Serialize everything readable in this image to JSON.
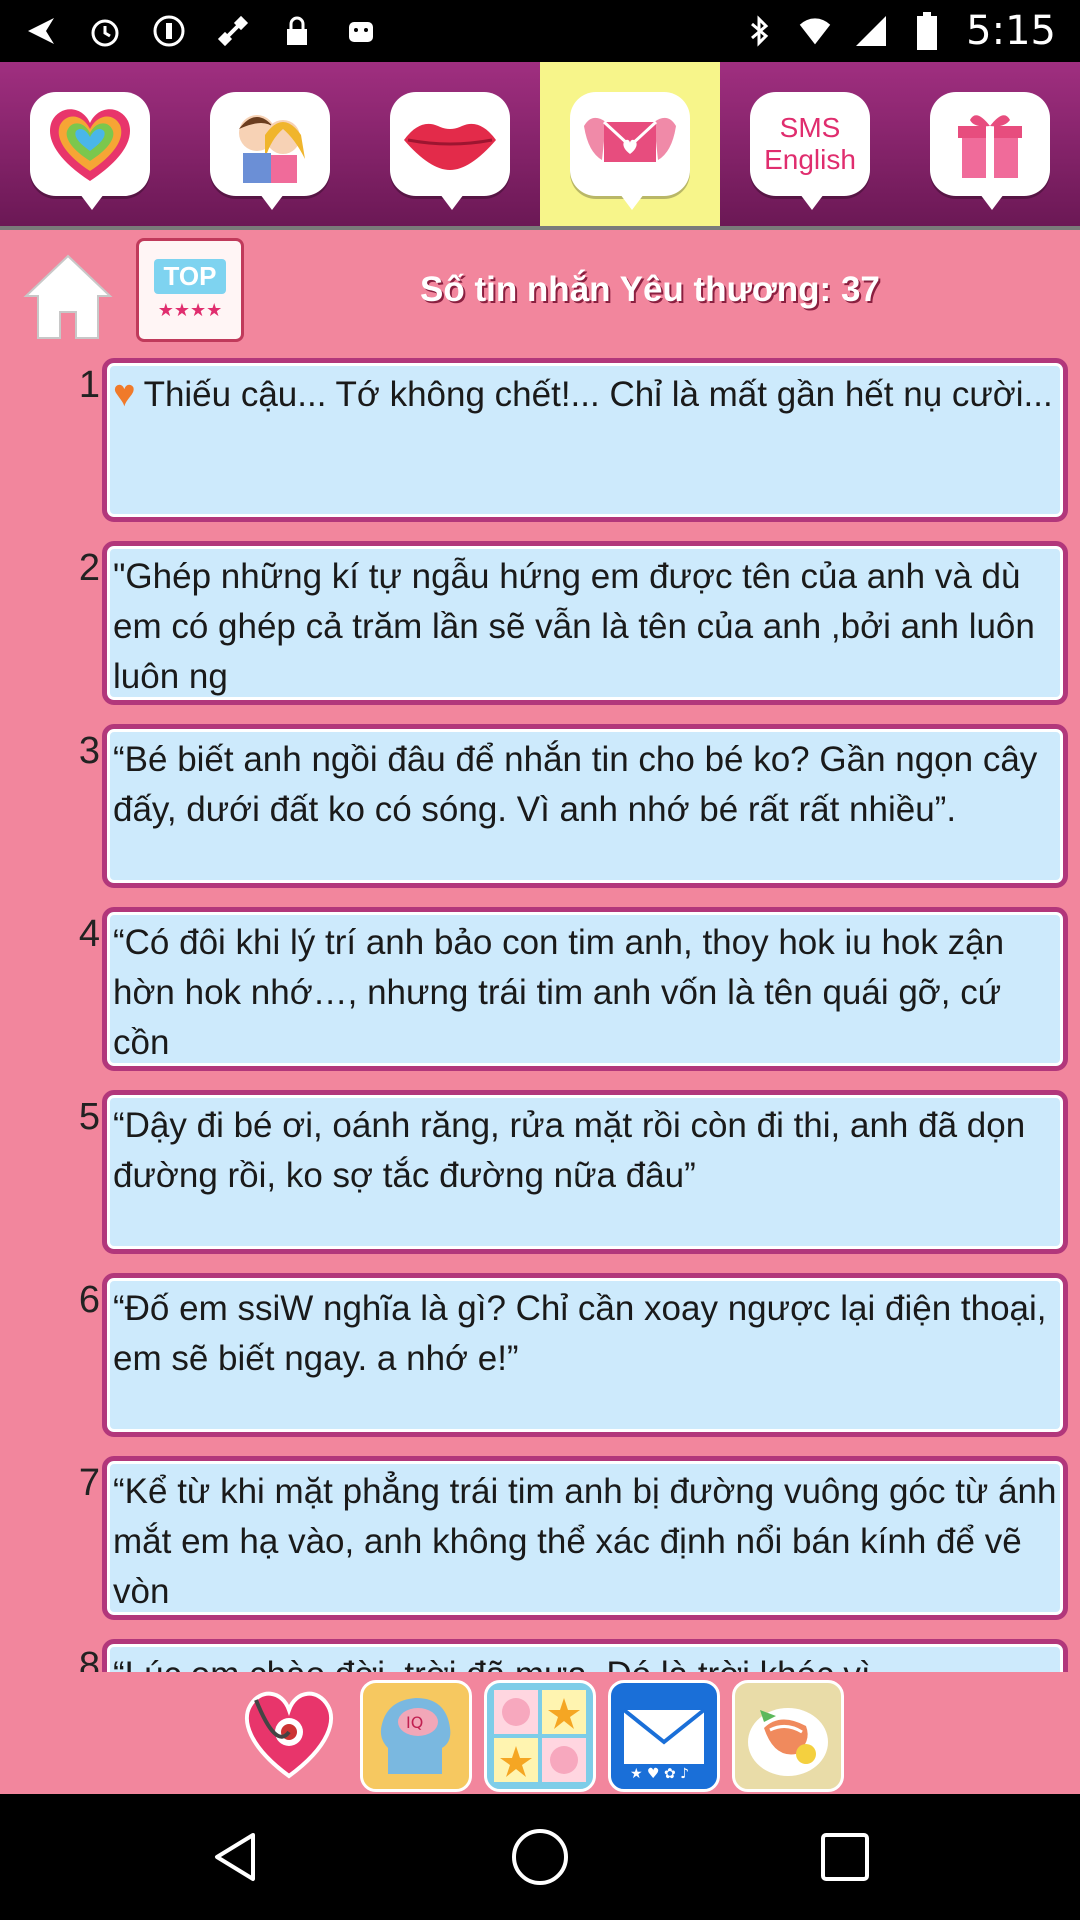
{
  "status_bar": {
    "time": "5:15",
    "left_icons": [
      "back-arrow-icon",
      "alarm-icon",
      "info-icon",
      "satellite-icon",
      "lock-icon",
      "android-icon"
    ],
    "right_icons": [
      "bluetooth-icon",
      "wifi-icon",
      "signal-icon",
      "battery-icon"
    ]
  },
  "categories": [
    {
      "name": "love-heart",
      "label": "I LOVE YOU!",
      "active": false
    },
    {
      "name": "couple",
      "label": "",
      "active": false
    },
    {
      "name": "lips",
      "label": "",
      "active": false
    },
    {
      "name": "envelope-wings",
      "label": "",
      "active": true
    },
    {
      "name": "sms-english",
      "label": "SMS English",
      "active": false
    },
    {
      "name": "gift",
      "label": "",
      "active": false
    }
  ],
  "header": {
    "home_label": "home",
    "top_label": "TOP",
    "count_title": "Số tin nhắn Yêu thương: 37"
  },
  "messages": [
    {
      "num": "1",
      "text": "Thiếu cậu... Tớ không chết!... Chỉ là mất gần hết nụ cười..."
    },
    {
      "num": "2",
      "text": "\"Ghép những kí tự ngẫu hứng em được tên của anh và dù em có ghép cả trăm lần sẽ vẫn là tên của anh ,bởi anh luôn luôn ng"
    },
    {
      "num": "3",
      "text": "“Bé biết anh ngồi đâu để nhắn tin cho bé ko? Gần ngọn cây đấy, dưới đất ko có sóng. Vì anh nhớ bé rất rất nhiều”."
    },
    {
      "num": "4",
      "text": "“Có đôi khi lý trí anh bảo con tim anh, thoy hok iu hok zận hờn hok nhớ…, nhưng trái tim anh vốn là tên quái gỡ, cứ cồn"
    },
    {
      "num": "5",
      "text": "“Dậy đi bé ơi, oánh răng, rửa mặt rồi còn đi thi, anh đã dọn đường rồi, ko sợ tắc đường nữa đâu”"
    },
    {
      "num": "6",
      "text": "“Đố em ssiW nghĩa là gì? Chỉ cần xoay ngược lại điện thoại, em sẽ biết ngay. a nhớ e!”"
    },
    {
      "num": "7",
      "text": "“Kể từ khi mặt phẳng trái tim anh bị đường vuông góc từ ánh mắt em hạ vào, anh không thể xác định nổi bán kính để vẽ vòn"
    },
    {
      "num": "8",
      "text": "“Lúc em chào đời, trời đã mưa. Đó là trời khóc vì"
    }
  ],
  "bottom_apps": [
    {
      "name": "stethoscope-heart-app",
      "label": "love test"
    },
    {
      "name": "iq-app",
      "label": "IQ"
    },
    {
      "name": "pig-star-game-app",
      "label": "game"
    },
    {
      "name": "mail-app",
      "label": "mail"
    },
    {
      "name": "food-app",
      "label": "food"
    }
  ],
  "nav": {
    "back": "back",
    "home": "home",
    "recents": "recents"
  },
  "colors": {
    "content_bg": "#f2869d",
    "msg_bg": "#cdeafc",
    "msg_border": "#b2377b",
    "topbar": "#a02f80",
    "active_tab": "#f7f58a"
  }
}
